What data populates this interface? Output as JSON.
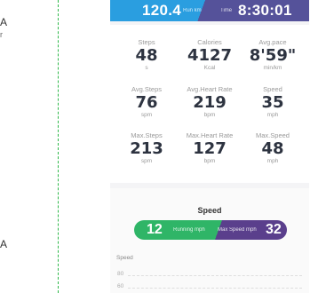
{
  "left_fragment": {
    "char1": "A",
    "char2": "r",
    "char3": "A"
  },
  "topbar": {
    "distance": "120.4",
    "distance_unit": "Run km",
    "time_label": "Time",
    "time": "8:30:01"
  },
  "stats": [
    {
      "label": "Steps",
      "value": "48",
      "unit": "s"
    },
    {
      "label": "Calories",
      "value": "4127",
      "unit": "Kcal"
    },
    {
      "label": "Avg.pace",
      "value": "8'59\"",
      "unit": "min/km"
    },
    {
      "label": "Avg.Steps",
      "value": "76",
      "unit": "spm"
    },
    {
      "label": "Avg.Heart Rate",
      "value": "219",
      "unit": "bpm"
    },
    {
      "label": "Speed",
      "value": "35",
      "unit": "mph"
    },
    {
      "label": "Max.Steps",
      "value": "213",
      "unit": "spm"
    },
    {
      "label": "Max.Heart Rate",
      "value": "127",
      "unit": "bpm"
    },
    {
      "label": "Max.Speed",
      "value": "48",
      "unit": "mph"
    }
  ],
  "speed": {
    "title": "Speed",
    "running_value": "12",
    "running_label": "Running mph",
    "max_label": "Max Speed mph",
    "max_value": "32",
    "axis_label": "Speed",
    "ticks": [
      "80",
      "60"
    ]
  },
  "colors": {
    "run_blue": "#2a9ee0",
    "time_purple": "#55529a",
    "pill_green": "#2fb567",
    "pill_purple": "#5a3f8c",
    "guide_green": "#2fb84a"
  }
}
